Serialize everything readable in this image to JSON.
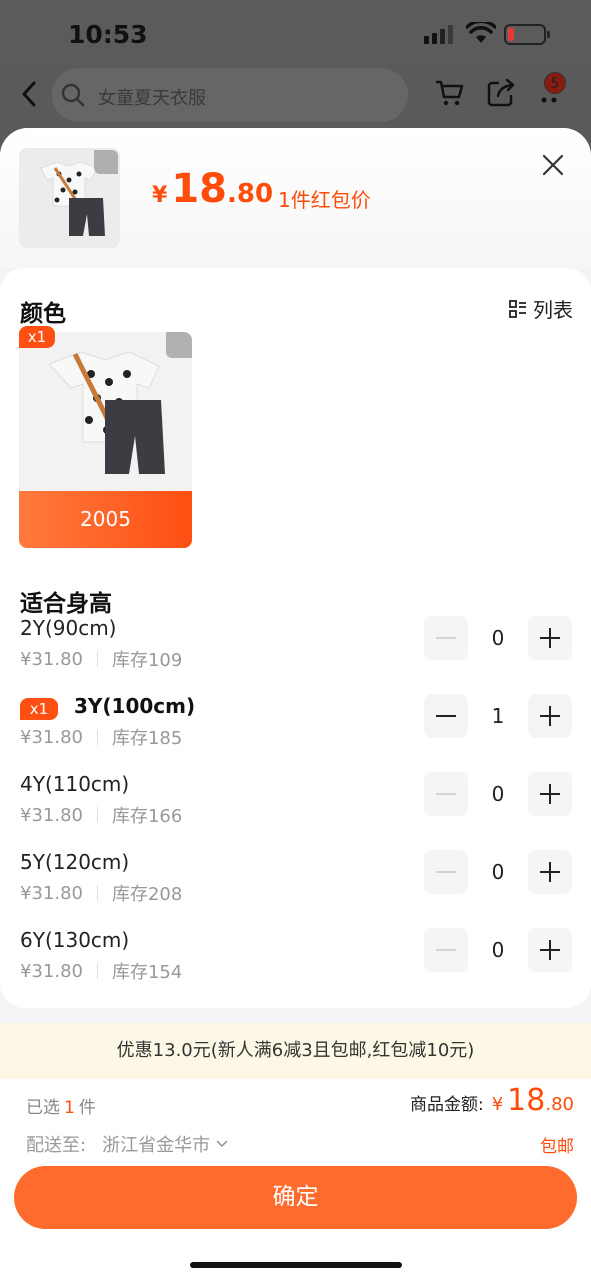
{
  "status_bar": {
    "time": "10:53"
  },
  "nav": {
    "search_placeholder": "女童夏天衣服",
    "message_badge": "5"
  },
  "header": {
    "currency": "¥",
    "price_int": "18",
    "price_dec": ".80",
    "price_note": "1件红包价"
  },
  "color_section": {
    "title": "颜色",
    "list_toggle": "列表",
    "options": [
      {
        "label": "2005",
        "qty_tag": "x1"
      }
    ]
  },
  "size_section": {
    "title": "适合身高",
    "rows": [
      {
        "name": "2Y(90cm)",
        "price": "¥31.80",
        "stock": "库存109",
        "qty": "0",
        "tag": ""
      },
      {
        "name": "3Y(100cm)",
        "price": "¥31.80",
        "stock": "库存185",
        "qty": "1",
        "tag": "x1"
      },
      {
        "name": "4Y(110cm)",
        "price": "¥31.80",
        "stock": "库存166",
        "qty": "0",
        "tag": ""
      },
      {
        "name": "5Y(120cm)",
        "price": "¥31.80",
        "stock": "库存208",
        "qty": "0",
        "tag": ""
      },
      {
        "name": "6Y(130cm)",
        "price": "¥31.80",
        "stock": "库存154",
        "qty": "0",
        "tag": ""
      }
    ]
  },
  "promo": "优惠13.0元(新人满6减3且包邮,红包减10元)",
  "footer": {
    "selected_prefix": "已选",
    "selected_count": "1",
    "selected_suffix": "件",
    "amount_label": "商品金额:",
    "amount_currency": "¥",
    "amount_int": "18",
    "amount_dec": ".80",
    "ship_label": "配送至:",
    "ship_address": "浙江省金华市",
    "ship_note": "包邮",
    "confirm": "确定"
  },
  "colors": {
    "accent": "#ff4f12",
    "confirm_bg": "#ff6a2d",
    "promo_bg": "#fdf8e6"
  }
}
